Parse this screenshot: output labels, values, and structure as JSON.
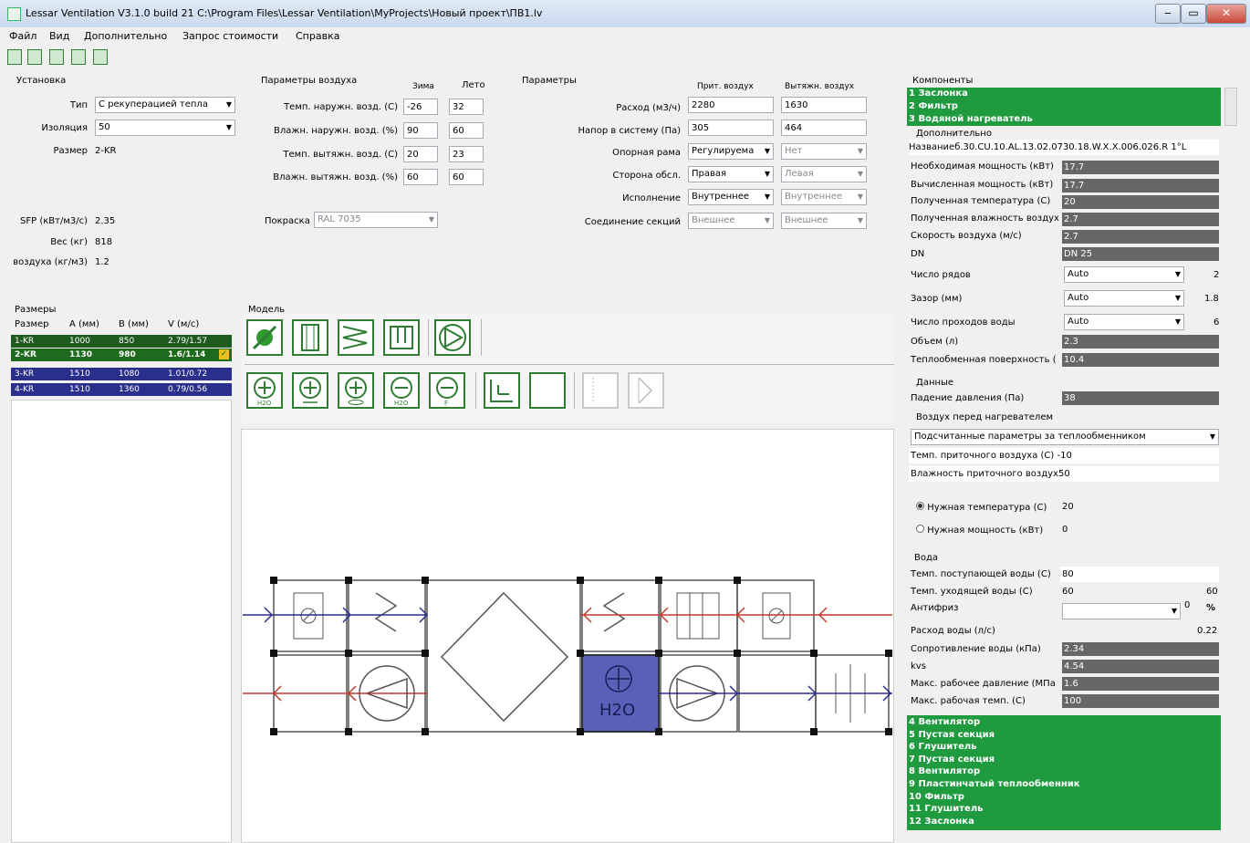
{
  "window": {
    "title": "Lessar Ventilation V3.1.0 build 21 C:\\Program Files\\Lessar Ventilation\\MyProjects\\Новый проект\\ПВ1.lv",
    "minimize": "‒",
    "maximize": "▭",
    "close": "✕"
  },
  "menu": [
    "Файл",
    "Вид",
    "Дополнительно",
    "Запрос стоимости",
    "Справка"
  ],
  "install": {
    "title": "Установка",
    "type_label": "Тип",
    "type_value": "С рекуперацией тепла",
    "insulation_label": "Изоляция",
    "insulation_value": "50",
    "size_label": "Размер",
    "size_value": "2-KR",
    "sfp_label": "SFP (кВт/м3/с)",
    "sfp_value": "2.35",
    "weight_label": "Вес (кг)",
    "weight_value": "818",
    "density_label": "воздуха (кг/м3)",
    "density_value": "1.2"
  },
  "air": {
    "title": "Параметры воздуха",
    "winter": "Зима",
    "summer": "Лето",
    "rows": [
      {
        "label": "Темп. наружн. возд. (С)",
        "winter": "-26",
        "summer": "32"
      },
      {
        "label": "Влажн. наружн. возд. (%)",
        "winter": "90",
        "summer": "60"
      },
      {
        "label": "Темп. вытяжн. возд. (С)",
        "winter": "20",
        "summer": "23"
      },
      {
        "label": "Влажн. вытяжн. возд. (%)",
        "winter": "60",
        "summer": "60"
      }
    ],
    "paint_label": "Покраска",
    "paint_value": "RAL 7035"
  },
  "params": {
    "title": "Параметры",
    "supply": "Прит. воздух",
    "exhaust": "Вытяжн. воздух",
    "flow_label": "Расход (м3/ч)",
    "flow_supply": "2280",
    "flow_exhaust": "1630",
    "press_label": "Напор в систему (Па)",
    "press_supply": "305",
    "press_exhaust": "464",
    "frame_label": "Опорная рама",
    "frame_supply": "Регулируема",
    "frame_exhaust": "Нет",
    "side_label": "Сторона обсл.",
    "side_supply": "Правая",
    "side_exhaust": "Левая",
    "exec_label": "Исполнение",
    "exec_supply": "Внутреннее",
    "exec_exhaust": "Внутреннее",
    "conn_label": "Соединение секций",
    "conn_supply": "Внешнее",
    "conn_exhaust": "Внешнее"
  },
  "sizes": {
    "title": "Размеры",
    "headers": [
      "Размер",
      "A (мм)",
      "B (мм)",
      "V (м/с)"
    ],
    "rows": [
      [
        "1-KR",
        "1000",
        "850",
        "2.79/1.57"
      ],
      [
        "2-KR",
        "1130",
        "980",
        "1.6/1.14"
      ],
      [
        "3-KR",
        "1510",
        "1080",
        "1.01/0.72"
      ],
      [
        "4-KR",
        "1510",
        "1360",
        "0.79/0.56"
      ]
    ]
  },
  "model": {
    "title": "Модель",
    "h2o": "H2O"
  },
  "components": {
    "title": "Компоненты",
    "top": [
      "1 Заслонка",
      "2 Фильтр",
      "3 Водяной нагреватель"
    ],
    "extra_title": "Дополнительно",
    "name_label": "Название",
    "name_value": "б.30.CU.10.AL.13.02.0730.18.W.X.X.006.026.R 1°L",
    "dark_rows": [
      {
        "label": "Необходимая мощность (кВт)",
        "value": "17.7"
      },
      {
        "label": "Вычисленная мощность (кВт)",
        "value": "17.7"
      },
      {
        "label": "Полученная температура (С)",
        "value": "20"
      },
      {
        "label": "Полученная влажность воздух",
        "value": "2.7"
      },
      {
        "label": "Скорость воздуха (м/с)",
        "value": "2.7"
      },
      {
        "label": "DN",
        "value": "DN 25"
      }
    ],
    "select_rows": [
      {
        "label": "Число рядов",
        "value": "Auto",
        "extra": "2"
      },
      {
        "label": "Зазор (мм)",
        "value": "Auto",
        "extra": "1.8"
      },
      {
        "label": "Число проходов воды",
        "value": "Auto",
        "extra": "6"
      }
    ],
    "volume_label": "Объем (л)",
    "volume_value": "2.3",
    "surface_label": "Теплообменная поверхность (",
    "surface_value": "10.4",
    "data_title": "Данные",
    "drop_label": "Падение давления (Па)",
    "drop_value": "38",
    "before_title": "Воздух перед нагревателем",
    "before_select": "Подсчитанные параметры за теплообменником",
    "supply_temp_label": "Темп. приточного воздуха (С)",
    "supply_temp_value": "-10",
    "supply_hum_label": "Влажность приточного воздух",
    "supply_hum_value": "50",
    "radio1_label": "Нужная температура (С)",
    "radio1_value": "20",
    "radio2_label": "Нужная мощность (кВт)",
    "radio2_value": "0",
    "water_title": "Вода",
    "water_in_label": "Темп. поступающей воды (С)",
    "water_in_value": "80",
    "water_out_label": "Темп. уходящей воды (С)",
    "water_out_value": "60",
    "water_out_extra": "60",
    "antifreeze_label": "Антифриз",
    "antifreeze_value": "0",
    "antifreeze_unit": "%",
    "water_flow_label": "Расход воды (л/с)",
    "water_flow_value": "0.22",
    "water_rows": [
      {
        "label": "Сопротивление воды (кПа)",
        "value": "2.34"
      },
      {
        "label": "kvs",
        "value": "4.54"
      },
      {
        "label": "Макс. рабочее давление (МПа",
        "value": "1.6"
      },
      {
        "label": "Макс. рабочая темп. (С)",
        "value": "100"
      }
    ],
    "bottom": [
      "4 Вентилятор",
      "5 Пустая секция",
      "6 Глушитель",
      "7 Пустая секция",
      "8 Вентилятор",
      "9 Пластинчатый теплообменник",
      "10 Фильтр",
      "11 Глушитель",
      "12 Заслонка"
    ]
  }
}
